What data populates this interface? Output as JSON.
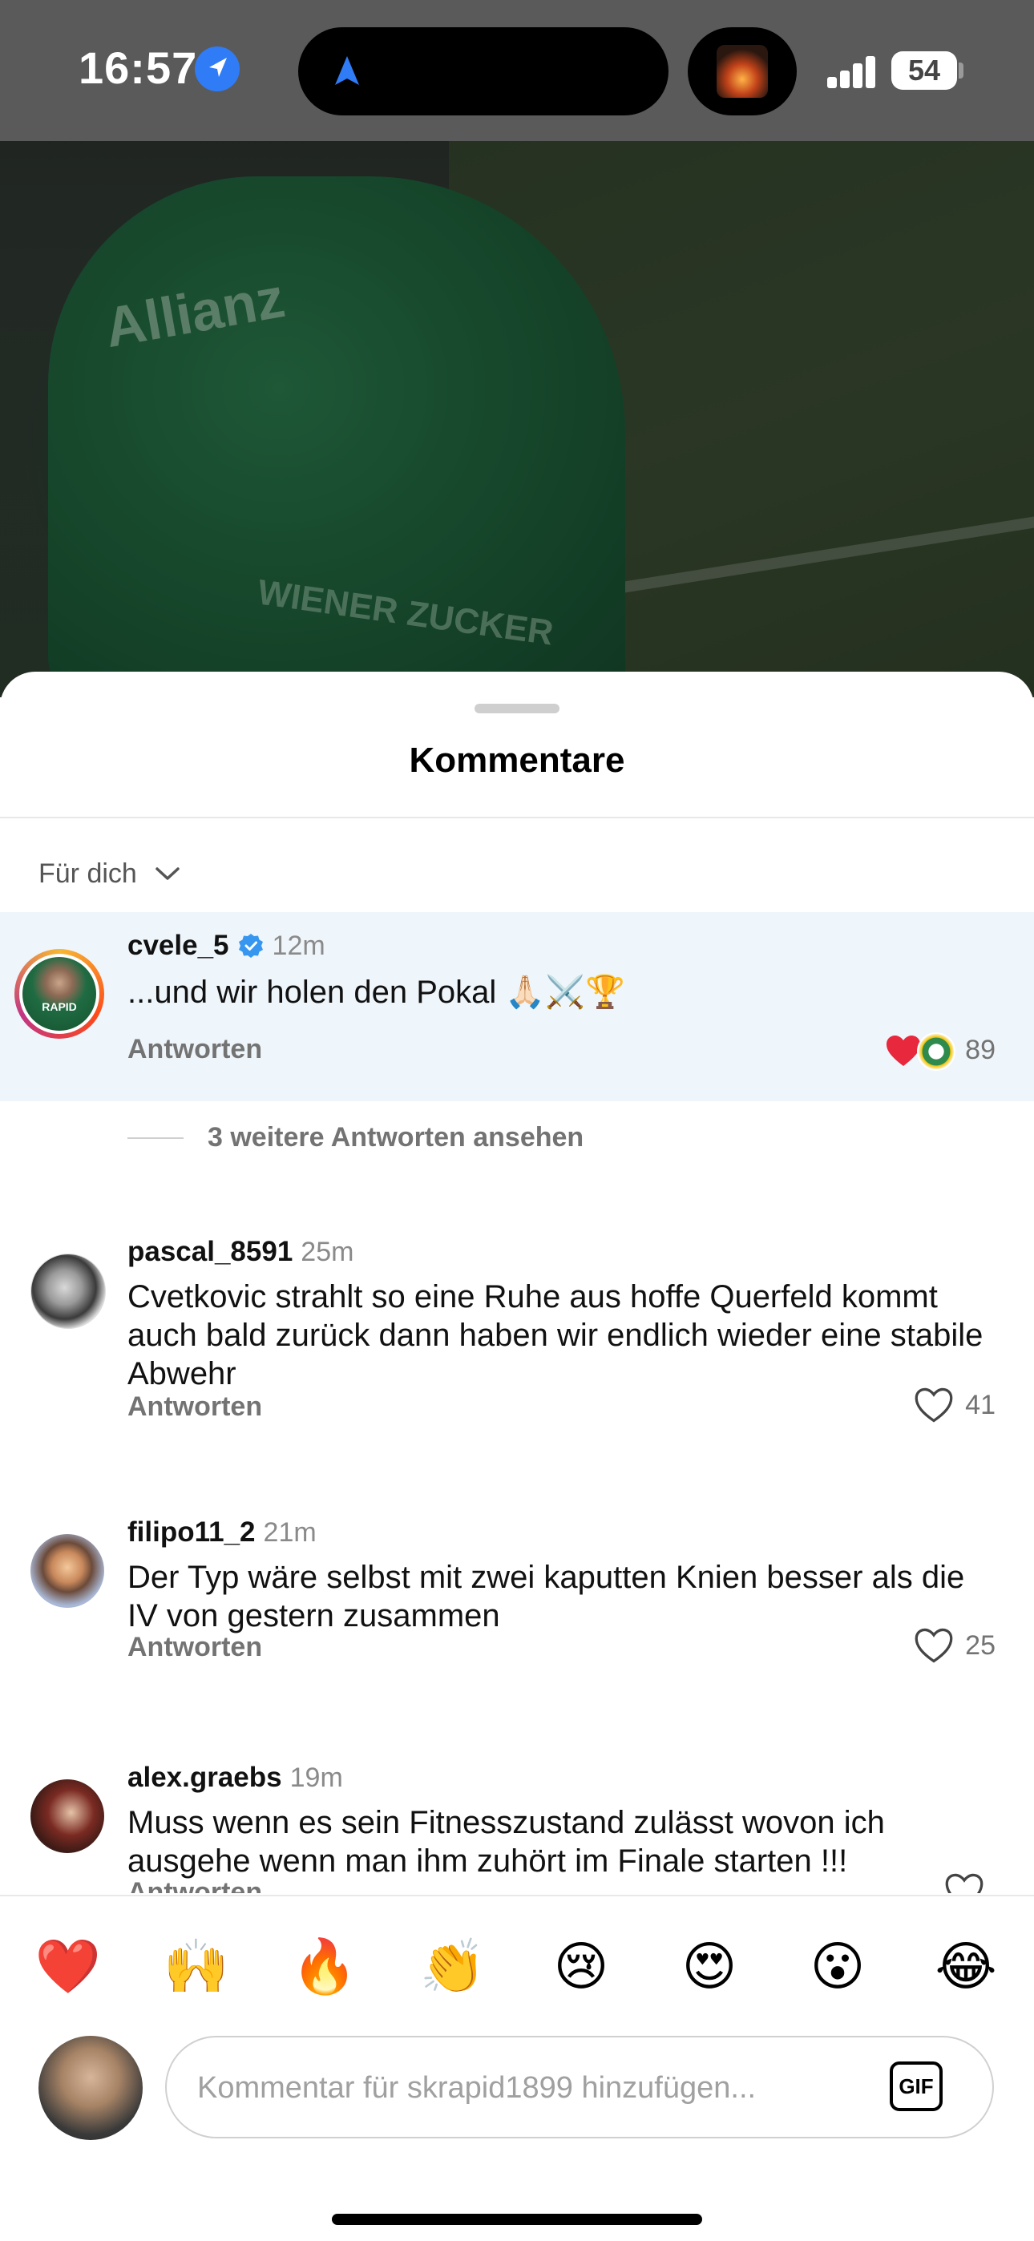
{
  "status_bar": {
    "time": "16:57",
    "battery": "54"
  },
  "video": {
    "jersey_sponsor": "Allianz",
    "jersey_sponsor2": "WIENER ZUCKER"
  },
  "sheet": {
    "title": "Kommentare",
    "sort": {
      "label": "Für dich"
    }
  },
  "comments": [
    {
      "username": "cvele_5",
      "verified": true,
      "time": "12m",
      "text": "...und wir holen den Pokal 🙏🏻⚔️🏆",
      "reply_label": "Antworten",
      "likes": "89",
      "liked_by_author": true,
      "avatar_text": "RAPID"
    },
    {
      "username": "pascal_8591",
      "time": "25m",
      "text": "Cvetkovic strahlt so eine Ruhe aus hoffe Querfeld kommt auch bald zurück dann haben wir endlich wieder eine stabile Abwehr",
      "reply_label": "Antworten",
      "likes": "41"
    },
    {
      "username": "filipo11_2",
      "time": "21m",
      "text": "Der Typ wäre selbst mit zwei kaputten Knien besser als die IV von gestern zusammen",
      "reply_label": "Antworten",
      "likes": "25"
    },
    {
      "username": "alex.graebs",
      "time": "19m",
      "text": "Muss wenn es sein Fitnesszustand zulässt wovon ich ausgehe wenn man ihm zuhört im Finale starten !!!",
      "reply_label": "Antworten",
      "likes": ""
    }
  ],
  "more_replies": "3 weitere Antworten ansehen",
  "emoji_bar": [
    "❤️",
    "🙌",
    "🔥",
    "👏",
    "😢",
    "😍",
    "😮",
    "😂"
  ],
  "composer": {
    "placeholder": "Kommentar für skrapid1899 hinzufügen...",
    "gif_label": "GIF"
  },
  "colors": {
    "accent": "#2f7cf6",
    "like_red": "#e8283c",
    "highlight": "#eef5fb"
  },
  "icons": [
    "location-arrow-icon",
    "navigation-icon",
    "signal-icon",
    "battery-icon",
    "chevron-down-icon",
    "verified-badge-icon",
    "heart-icon",
    "gif-icon"
  ]
}
